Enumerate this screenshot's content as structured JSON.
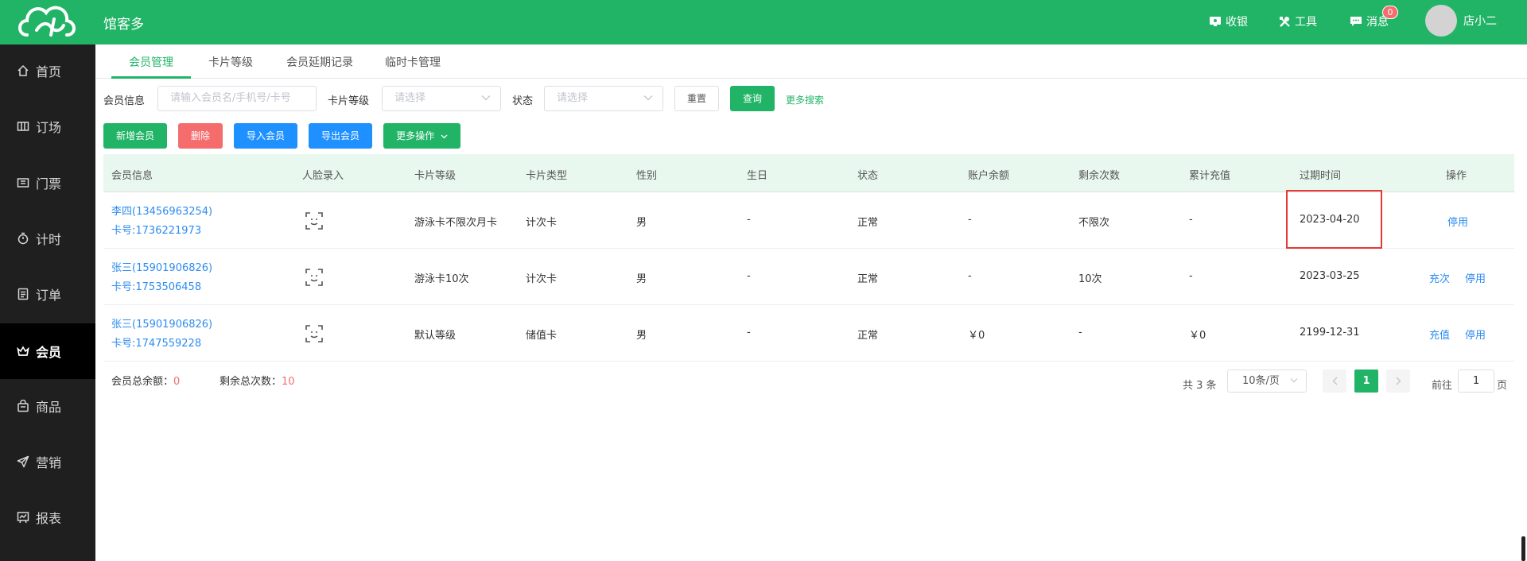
{
  "app": {
    "name": "馆客多"
  },
  "header": {
    "cashier": "收银",
    "tools": "工具",
    "messages": "消息",
    "message_count": "0",
    "username": "店小二"
  },
  "sidebar": {
    "items": [
      {
        "label": "首页",
        "icon": "home-icon"
      },
      {
        "label": "订场",
        "icon": "venue-icon"
      },
      {
        "label": "门票",
        "icon": "ticket-icon"
      },
      {
        "label": "计时",
        "icon": "timer-icon"
      },
      {
        "label": "订单",
        "icon": "order-icon"
      },
      {
        "label": "会员",
        "icon": "member-icon",
        "active": true
      },
      {
        "label": "商品",
        "icon": "goods-icon"
      },
      {
        "label": "营销",
        "icon": "marketing-icon"
      },
      {
        "label": "报表",
        "icon": "report-icon"
      }
    ]
  },
  "tabs": [
    {
      "label": "会员管理",
      "active": true
    },
    {
      "label": "卡片等级"
    },
    {
      "label": "会员延期记录"
    },
    {
      "label": "临时卡管理"
    }
  ],
  "filters": {
    "member_label": "会员信息",
    "member_placeholder": "请输入会员名/手机号/卡号",
    "level_label": "卡片等级",
    "level_placeholder": "请选择",
    "status_label": "状态",
    "status_placeholder": "请选择",
    "reset": "重置",
    "query": "查询",
    "more_search": "更多搜索"
  },
  "actions": {
    "add": "新增会员",
    "delete": "删除",
    "import": "导入会员",
    "export": "导出会员",
    "more": "更多操作"
  },
  "table": {
    "columns": [
      "会员信息",
      "人脸录入",
      "卡片等级",
      "卡片类型",
      "性别",
      "生日",
      "状态",
      "账户余额",
      "剩余次数",
      "累计充值",
      "过期时间",
      "操作"
    ],
    "rows": [
      {
        "name": "李四(13456963254)",
        "card": "卡号:1736221973",
        "level": "游泳卡不限次月卡",
        "type": "计次卡",
        "gender": "男",
        "birthday": "-",
        "status": "正常",
        "balance": "-",
        "remaining": "不限次",
        "recharged": "-",
        "expire": "2023-04-20",
        "ops": [
          "停用"
        ]
      },
      {
        "name": "张三(15901906826)",
        "card": "卡号:1753506458",
        "level": "游泳卡10次",
        "type": "计次卡",
        "gender": "男",
        "birthday": "-",
        "status": "正常",
        "balance": "-",
        "remaining": "10次",
        "recharged": "-",
        "expire": "2023-03-25",
        "ops": [
          "充次",
          "停用"
        ]
      },
      {
        "name": "张三(15901906826)",
        "card": "卡号:1747559228",
        "level": "默认等级",
        "type": "储值卡",
        "gender": "男",
        "birthday": "-",
        "status": "正常",
        "balance": "￥0",
        "remaining": "-",
        "recharged": "￥0",
        "expire": "2199-12-31",
        "ops": [
          "充值",
          "停用"
        ]
      }
    ]
  },
  "summary": {
    "balance_label": "会员总余额：",
    "balance_value": "0",
    "count_label": "剩余总次数：",
    "count_value": "10"
  },
  "pagination": {
    "total": "共 3 条",
    "page_size": "10条/页",
    "current": "1",
    "goto_label": "前往",
    "goto_value": "1",
    "page_unit": "页"
  },
  "colors": {
    "brand": "#22b466",
    "sidebar": "#1f1f1f",
    "link": "#2d8cf0",
    "danger": "#f56c6c",
    "highlight": "#e53935"
  }
}
